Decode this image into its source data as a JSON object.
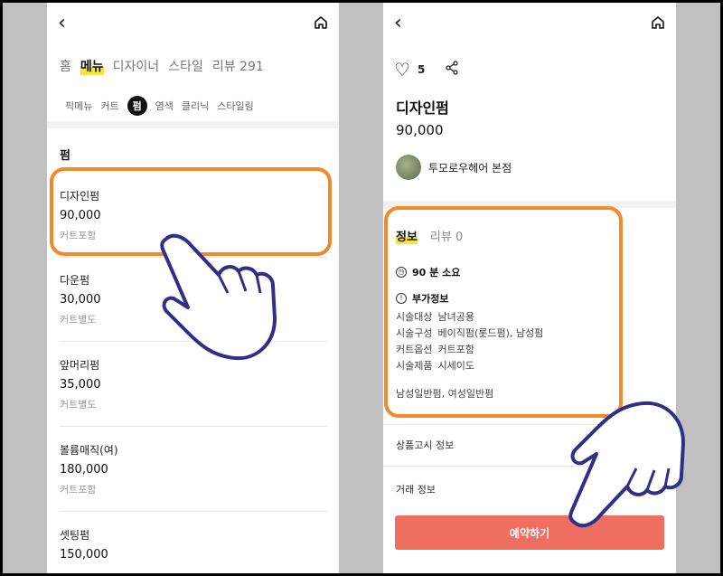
{
  "left": {
    "tabs": [
      "홈",
      "메뉴",
      "디자이너",
      "스타일",
      "리뷰 291"
    ],
    "subtabs": [
      "픽메뉴",
      "커트",
      "펌",
      "염색",
      "클리닉",
      "스타일링"
    ],
    "section_title": "펌",
    "items": [
      {
        "name": "디자인펌",
        "price": "90,000",
        "desc": "커트포함"
      },
      {
        "name": "다운펌",
        "price": "30,000",
        "desc": "커트별도"
      },
      {
        "name": "앞머리펌",
        "price": "35,000",
        "desc": "커트별도"
      },
      {
        "name": "볼륨매직(여)",
        "price": "180,000",
        "desc": "커트포함"
      },
      {
        "name": "셋팅펌",
        "price": "150,000",
        "desc": ""
      }
    ]
  },
  "right": {
    "like_count": "5",
    "title": "디자인펌",
    "price": "90,000",
    "shop_name": "투모로우헤어 본점",
    "info_tabs": [
      "정보",
      "리뷰 0"
    ],
    "duration": "90 분 소요",
    "extra_title": "부가정보",
    "details": [
      {
        "label": "시술대상",
        "value": "남녀공용"
      },
      {
        "label": "시술구성",
        "value": "베이직펌(롯드펌), 남성펌"
      },
      {
        "label": "커트옵션",
        "value": "커트포함"
      },
      {
        "label": "시술제품",
        "value": "시세이도"
      }
    ],
    "tags": "남성일반펌, 여성일반펌",
    "link1": "상품고시 정보",
    "link2": "거래 정보",
    "book_button": "예약하기"
  },
  "colors": {
    "accent": "#f7e43a",
    "annotation": "#f08a2a",
    "button": "#ee6f5f"
  },
  "icons": [
    "chevron-left-icon",
    "home-icon",
    "heart-icon",
    "share-icon",
    "clock-icon",
    "info-icon",
    "pointing-hand-icon"
  ]
}
